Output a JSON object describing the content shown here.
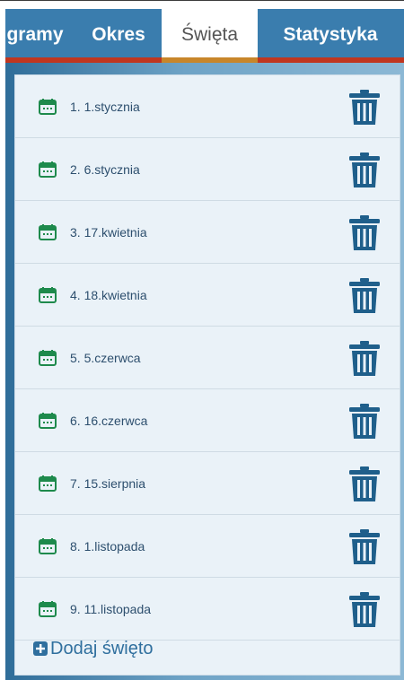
{
  "tabs": [
    {
      "label": "gramy",
      "active": false
    },
    {
      "label": "Okres",
      "active": false
    },
    {
      "label": "Święta",
      "active": true
    },
    {
      "label": "Statystyka",
      "active": false
    }
  ],
  "holidays": [
    {
      "label": "1. 1.stycznia"
    },
    {
      "label": "2. 6.stycznia"
    },
    {
      "label": "3. 17.kwietnia"
    },
    {
      "label": "4. 18.kwietnia"
    },
    {
      "label": "5. 5.czerwca"
    },
    {
      "label": "6. 16.czerwca"
    },
    {
      "label": "7. 15.sierpnia"
    },
    {
      "label": "8. 1.listopada"
    },
    {
      "label": "9. 11.listopada"
    }
  ],
  "add_button": {
    "label": "Dodaj święto"
  },
  "colors": {
    "tab_bar": "#3a7dae",
    "accent_underline": "#c8862a",
    "red_bar": "#c0361f",
    "calendar_icon": "#1e8a4c",
    "trash_icon": "#1f5f8b",
    "list_bg": "#eaf2f8"
  }
}
